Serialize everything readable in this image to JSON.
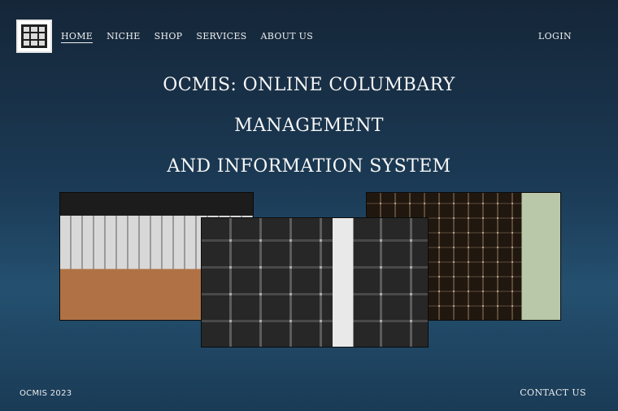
{
  "nav": {
    "items": [
      {
        "label": "HOME",
        "active": true
      },
      {
        "label": "NICHE"
      },
      {
        "label": "SHOP"
      },
      {
        "label": "SERVICES"
      },
      {
        "label": "ABOUT US"
      }
    ],
    "login": "LOGIN"
  },
  "hero": {
    "line1": "OCMIS: ONLINE COLUMBARY",
    "line2": "MANAGEMENT",
    "line3": "AND INFORMATION SYSTEM"
  },
  "gallery": {
    "photos": [
      "columbary-hall-photo",
      "niche-wall-closeup-photo",
      "outdoor-niche-wall-photo"
    ]
  },
  "footer": {
    "copyright": "OCMIS 2023",
    "contact": "CONTACT US"
  },
  "colors": {
    "background_top": "#152638",
    "background_mid": "#24506f",
    "text": "#f3f3f3"
  }
}
